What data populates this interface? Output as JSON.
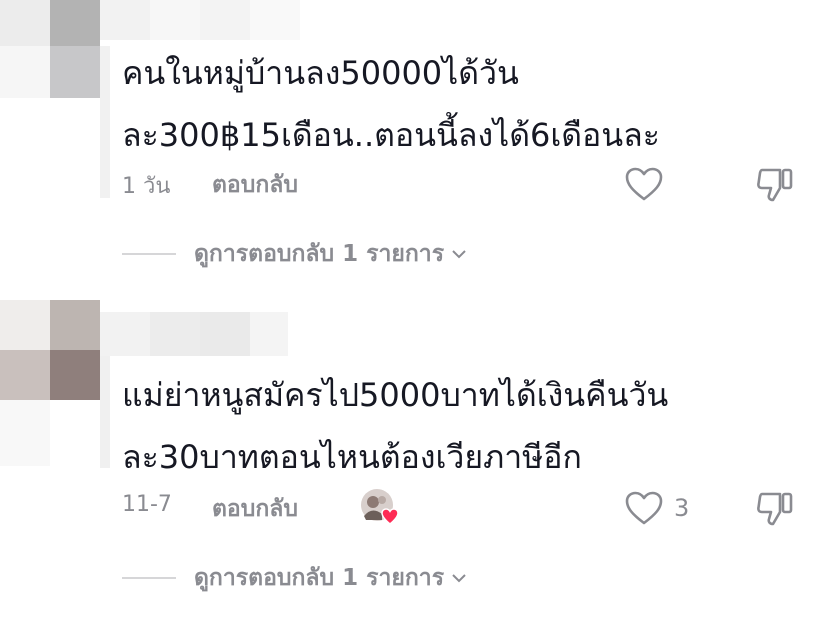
{
  "colors": {
    "text": "#161823",
    "secondary": "#8a8b91",
    "divider": "#d6d6d8",
    "heart_badge": "#fe2c55"
  },
  "comments": [
    {
      "text_line1": "คนในหมู่บ้านลง50000ได้วัน",
      "text_line2": "ละ300฿15เดือน..ตอนนี้ลงได้6เดือนละ",
      "date": "1 วัน",
      "reply_label": "ตอบกลับ",
      "like_count": "",
      "liked_by_creator": false,
      "view_replies_label": "ดูการตอบกลับ 1 รายการ"
    },
    {
      "text_line1": "แม่ย่าหนูสมัครไป5000บาทได้เงินคืนวัน",
      "text_line2": "ละ30บาทตอนไหนต้องเวียภาษีอีก",
      "date": "11-7",
      "reply_label": "ตอบกลับ",
      "like_count": "3",
      "liked_by_creator": true,
      "view_replies_label": "ดูการตอบกลับ 1 รายการ"
    }
  ],
  "icons": {
    "like": "heart-outline-icon",
    "dislike": "thumbs-down-outline-icon",
    "expand": "chevron-down-icon"
  }
}
